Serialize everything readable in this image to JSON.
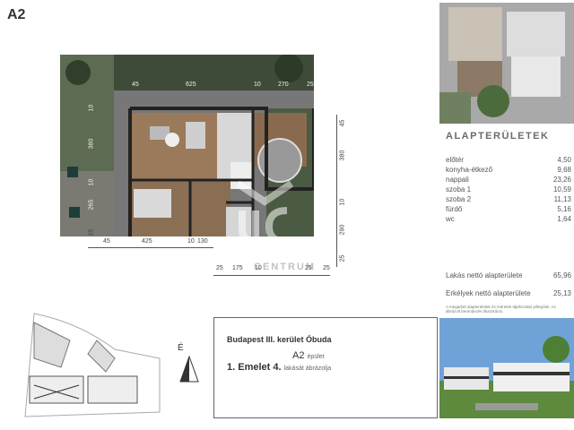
{
  "header": {
    "unit_code": "A2"
  },
  "plan": {
    "dims_top": [
      "45",
      "625",
      "10",
      "270",
      "25"
    ],
    "dims_bottom": [
      "45",
      "425",
      "10",
      "130"
    ],
    "dims_bottom2": [
      "25",
      "175",
      "10",
      "25",
      "25"
    ],
    "dims_left": [
      "10",
      "380",
      "10",
      "265",
      "25"
    ],
    "dims_right": [
      "45",
      "380",
      "10",
      "290",
      "25"
    ]
  },
  "areas": {
    "title": "ALAPTERÜLETEK",
    "rows": [
      {
        "label": "előtér",
        "value": "4,50"
      },
      {
        "label": "konyha-étkező",
        "value": "9,68"
      },
      {
        "label": "nappali",
        "value": "23,26"
      },
      {
        "label": "szoba 1",
        "value": "10,59"
      },
      {
        "label": "szoba 2",
        "value": "11,13"
      },
      {
        "label": "fürdő",
        "value": "5,16"
      },
      {
        "label": "wc",
        "value": "1,64"
      }
    ],
    "net_label": "Lakás nettó alapterülete",
    "net_value": "65,96",
    "balcony_label": "Erkélyek nettó alapterülete",
    "balcony_value": "25,13",
    "note": "A megadott alapterületek és méretek tájékoztató jellegűek. Az ábrázolt berendezés illusztráció."
  },
  "info": {
    "location": "Budapest III. kerület Óbuda",
    "building": "A2",
    "building_suffix": "épület",
    "floor": "1. Emelet 4.",
    "floor_suffix": "lakását ábrázolja"
  },
  "compass": {
    "label": "É"
  },
  "watermark": {
    "line1": "OTTHON",
    "line2": "CENTRUM"
  }
}
